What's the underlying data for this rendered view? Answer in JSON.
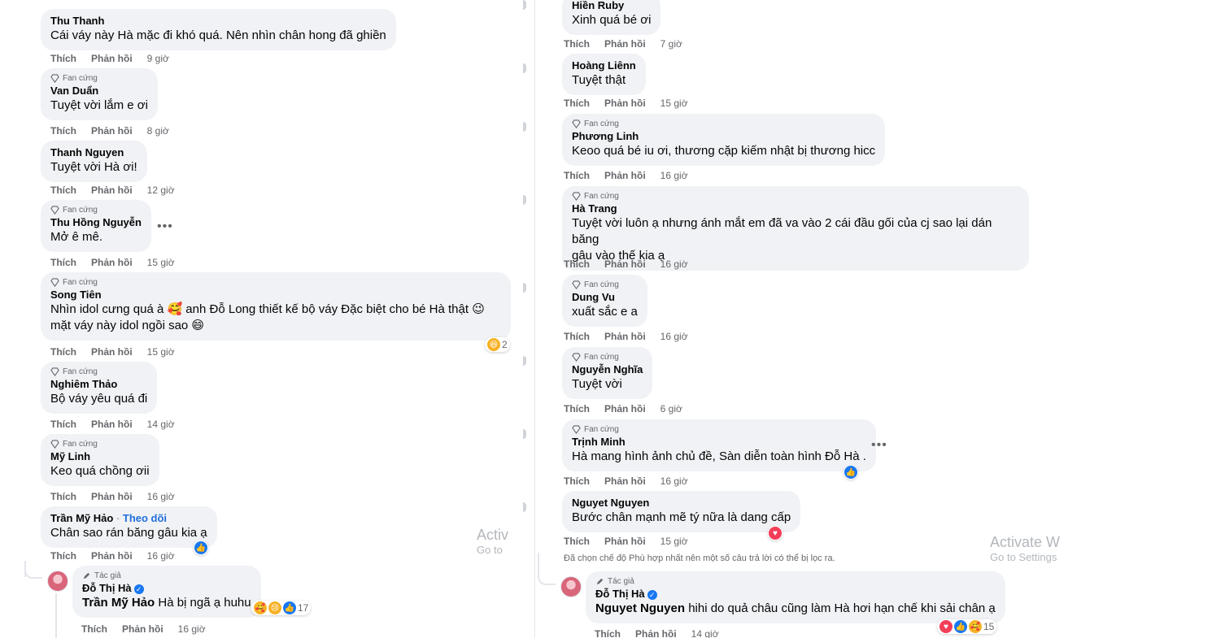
{
  "labels": {
    "like": "Thích",
    "reply": "Phản hồi",
    "fan_badge": "Fan cứng",
    "author_badge": "Tác giả",
    "follow": "Theo dõi"
  },
  "left": {
    "comments": [
      {
        "name": "Thu Thanh",
        "text": "Cái váy này Hà mặc đi khó quá. Nên nhìn chân hong đã ghiền",
        "time": "9 giờ"
      },
      {
        "name": "Van Duẩn",
        "text": "Tuyệt vời lắm e ơi",
        "time": "8 giờ",
        "fan": true
      },
      {
        "name": "Thanh Nguyen",
        "text": "Tuyệt vời Hà ơi!",
        "time": "12 giờ"
      },
      {
        "name": "Thu Hồng Nguyễn",
        "text": "Mở ê mê.",
        "time": "15 giờ",
        "fan": true
      },
      {
        "name": "Song Tiên",
        "text": "Nhìn idol cưng quá à 🥰 anh Đỗ Long thiết kế bộ váy Đặc biệt cho bé Hà thật 😉\nmặt váy này idol ngồi sao 😄",
        "time": "15 giờ",
        "fan": true,
        "reaction_count": "2"
      },
      {
        "name": "Nghiêm Thảo",
        "text": "Bộ váy yêu quá đi",
        "time": "14 giờ",
        "fan": true
      },
      {
        "name": "Mỹ Linh",
        "text": "Keo quá chồng ơii",
        "time": "16 giờ",
        "fan": true
      },
      {
        "name": "Trần Mỹ Hảo",
        "text": "Chân sao rán băng gâu kia ạ",
        "time": "16 giờ"
      }
    ],
    "author_reply": {
      "name": "Đỗ Thị Hà",
      "target": "Trần Mỹ Hảo",
      "text": "Hà bị ngã ạ huhu",
      "reaction_count": "17",
      "time": "16 giờ"
    },
    "watermark": {
      "line1": "Activ",
      "line2": "Go to"
    }
  },
  "right": {
    "comments": [
      {
        "name": "Hiền Ruby",
        "text": "Xinh quá bé ơi",
        "time": "7 giờ"
      },
      {
        "name": "Hoàng Liênn",
        "text": "Tuyệt thật",
        "time": "15 giờ"
      },
      {
        "name": "Phương Linh",
        "text": "Keoo quá bé iu ơi, thương cặp kiếm nhật bị thương hicc",
        "time": "16 giờ",
        "fan": true
      },
      {
        "name": "Hà Trang",
        "text": "Tuyệt vời luôn ạ nhưng ánh mắt em đã va vào 2 cái đầu gối của cj sao lại dán băng\ngâu vào thế kia ạ",
        "time": "16 giờ",
        "fan": true
      },
      {
        "name": "Dung Vu",
        "text": "xuất sắc e a",
        "time": "16 giờ",
        "fan": true
      },
      {
        "name": "Nguyễn Nghĩa",
        "text": "Tuyệt vời",
        "time": "6 giờ",
        "fan": true
      },
      {
        "name": "Trịnh Minh",
        "text": "Hà mang hình ảnh chủ đề, Sàn diễn toàn hình Đỗ Hà .",
        "time": "16 giờ",
        "fan": true
      },
      {
        "name": "Nguyet Nguyen",
        "text": "Bước chân mạnh mẽ tý nữa là dang cấp",
        "time": "15 giờ"
      }
    ],
    "filter_note": "Đã chọn chế độ Phù hợp nhất nên một số câu trả lời có thể bị lọc ra.",
    "author_reply": {
      "name": "Đỗ Thị Hà",
      "target": "Nguyet Nguyen",
      "text": "hihi do quả châu cũng làm Hà hơi hạn chế khi sải chân ạ",
      "reaction_count": "15",
      "time": "14 giờ"
    },
    "watermark": {
      "line1": "Activate W",
      "line2": "Go to Settings"
    }
  }
}
